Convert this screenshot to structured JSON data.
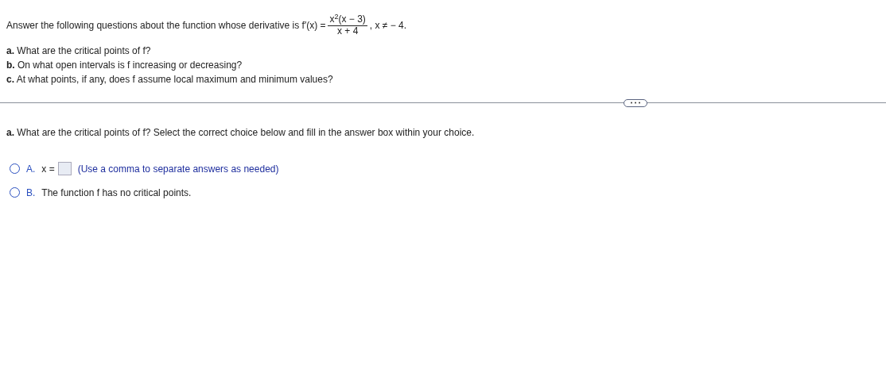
{
  "intro": {
    "before": "Answer the following questions about the function whose derivative is f′(x) =",
    "numerator": "x$^{2}$(x − 3)",
    "denominator": "x + 4",
    "after": ", x ≠ − 4."
  },
  "questions": [
    "**a.** What are the critical points of f?",
    "**b.** On what open intervals is f increasing or decreasing?",
    "**c.** At what points, if any, does f assume local maximum and minimum values?"
  ],
  "prompt": "**a.** What are the critical points of f? Select the correct choice below and fill in the answer box within your choice.",
  "choices": [
    {
      "kind": "answer",
      "letter": "A.",
      "label": "x =",
      "hint": "(Use a comma to separate answers as needed)",
      "selected": false
    },
    {
      "kind": "text",
      "letter": "B.",
      "text": "The function f has no critical points.",
      "selected": false
    }
  ]
}
